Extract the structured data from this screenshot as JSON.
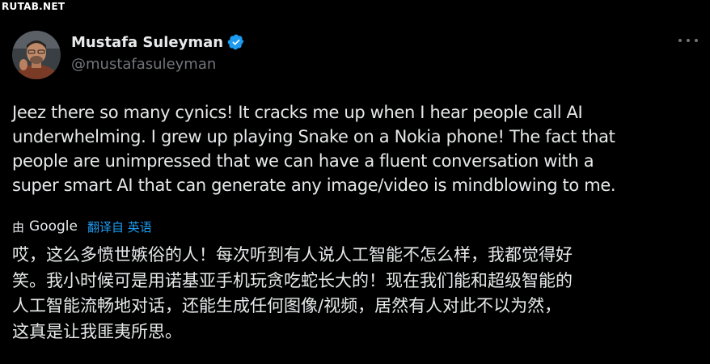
{
  "watermark": "RUTAB.NET",
  "author": {
    "display_name": "Mustafa Suleyman",
    "handle": "@mustafasuleyman",
    "verified": true,
    "verified_color": "#1d9bf0"
  },
  "tweet": {
    "text_lines": [
      "Jeez there so many cynics! It cracks me up when I hear people call AI",
      "underwhelming. I grew up playing Snake on a Nokia phone! The fact that",
      "people are unimpressed that we can have a fluent conversation with a",
      "super smart AI that can generate any image/video is mindblowing to me."
    ]
  },
  "translation": {
    "by_label": "由",
    "provider": "Google",
    "translated_from_label": "翻译自 英语",
    "text_lines": [
      "哎，这么多愤世嫉俗的人！每次听到有人说人工智能不怎么样，我都觉得好",
      "笑。我小时候可是用诺基亚手机玩贪吃蛇长大的！现在我们能和超级智能的",
      "人工智能流畅地对话，还能生成任何图像/视频，居然有人对此不以为然，",
      "这真是让我匪夷所思。"
    ]
  },
  "more_icon": "more-horizontal-icon",
  "colors": {
    "background": "#000000",
    "text": "#e7e9ea",
    "secondary": "#71767b",
    "link": "#1d9bf0"
  }
}
